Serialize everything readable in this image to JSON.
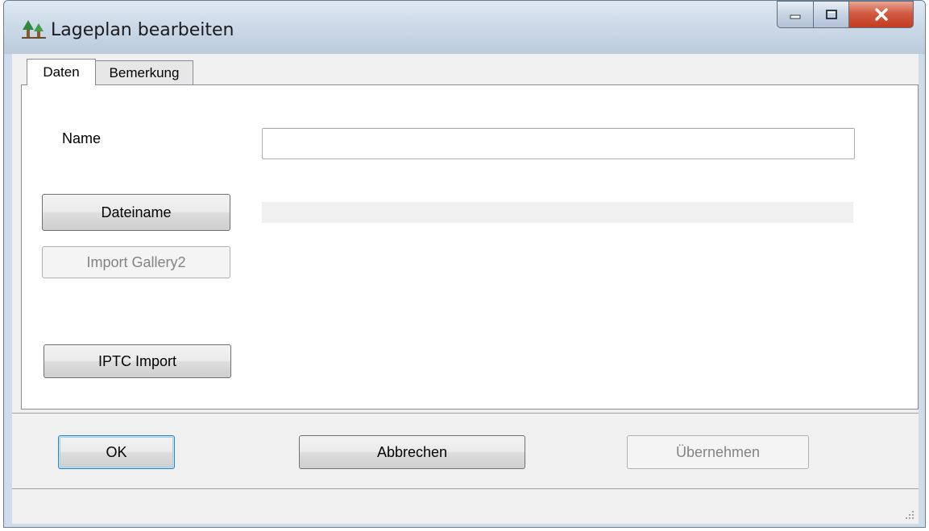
{
  "window": {
    "title": "Lageplan bearbeiten",
    "icon": "app-tree-icon"
  },
  "caption_buttons": {
    "minimize": "minimize-icon",
    "maximize": "maximize-icon",
    "close": "close-icon"
  },
  "tabs": [
    {
      "label": "Daten",
      "active": true
    },
    {
      "label": "Bemerkung",
      "active": false
    }
  ],
  "form": {
    "name_label": "Name",
    "name_value": "",
    "dateiname_button": "Dateiname",
    "dateiname_value": "",
    "import_gallery_button": "Import Gallery2",
    "iptc_button": "IPTC Import"
  },
  "footer": {
    "ok_button": "OK",
    "cancel_button": "Abbrechen",
    "apply_button": "Übernehmen"
  },
  "colors": {
    "accent_default_button": "#3c7fb1",
    "close_button": "#c33c20"
  }
}
